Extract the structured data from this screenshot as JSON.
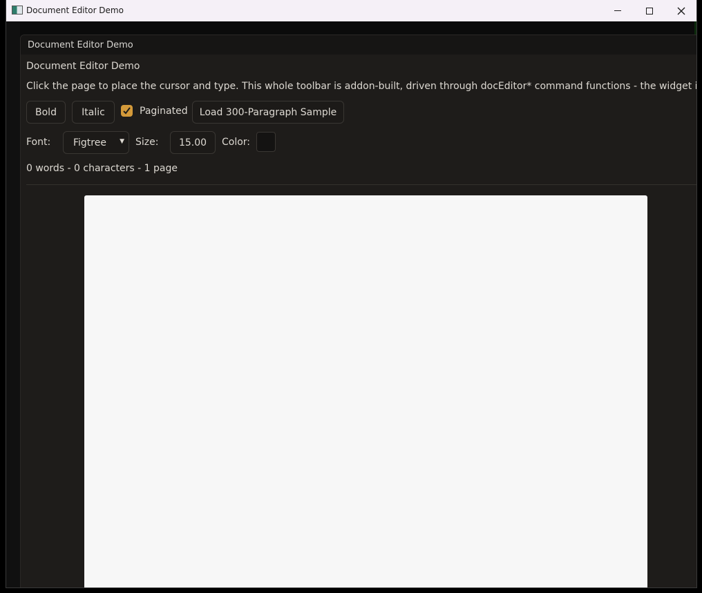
{
  "window": {
    "title": "Document Editor Demo",
    "controls": {
      "minimize": "minimize-icon",
      "maximize": "maximize-icon",
      "close": "close-icon"
    }
  },
  "panel": {
    "title": "Document Editor Demo",
    "heading": "Document Editor Demo",
    "description": "Click the page to place the cursor and type. This whole toolbar is addon-built, driven through docEditor* command functions - the widget itself"
  },
  "toolbar": {
    "bold_label": "Bold",
    "italic_label": "Italic",
    "paginated_label": "Paginated",
    "paginated_checked": true,
    "load_sample_label": "Load 300-Paragraph Sample",
    "font_label": "Font:",
    "font_value": "Figtree",
    "size_label": "Size:",
    "size_value": "15.00",
    "color_label": "Color:",
    "color_value": "#141312"
  },
  "status": {
    "counts": "0 words - 0 characters - 1 page"
  },
  "colors": {
    "accent": "#d49a3a",
    "panel_bg": "#1e1c1a",
    "page_bg": "#f7f7f7"
  }
}
